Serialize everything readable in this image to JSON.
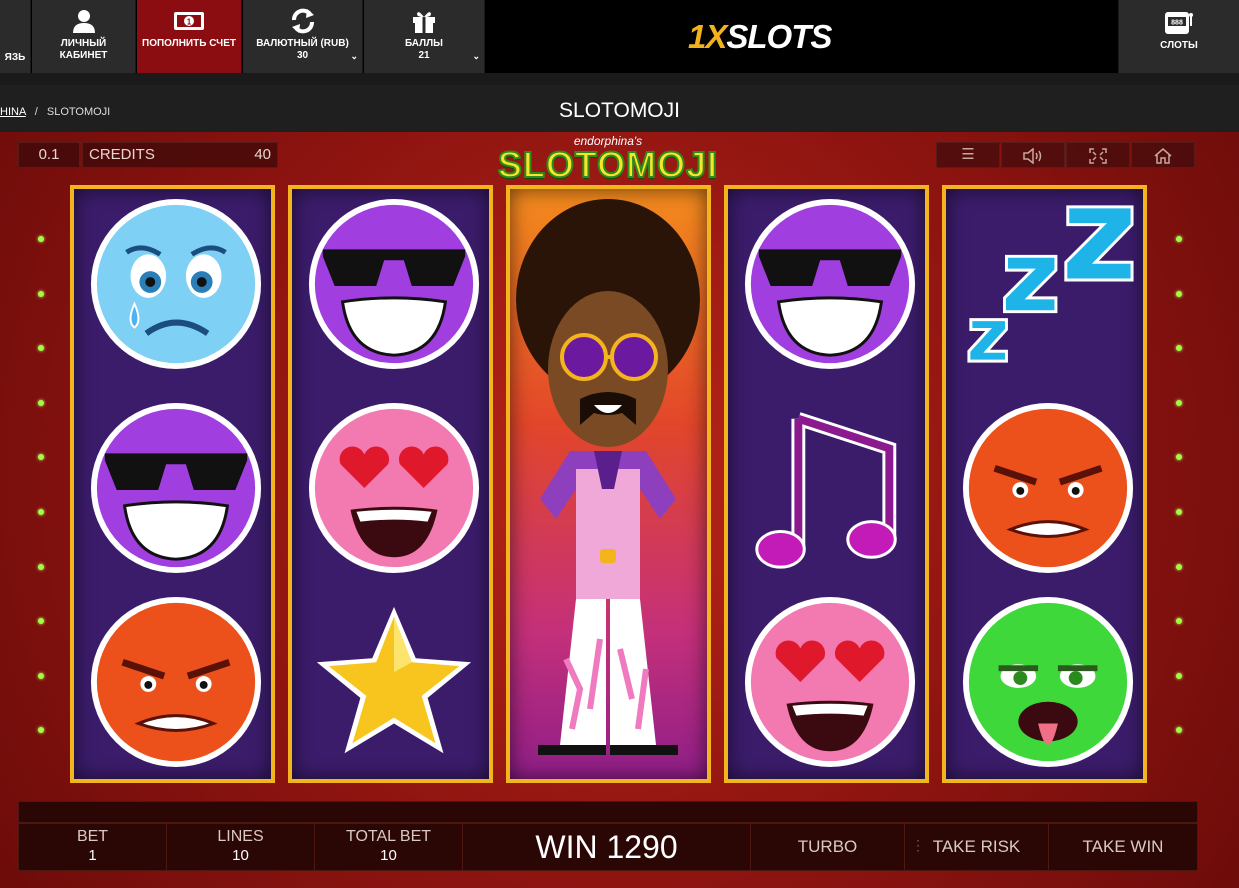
{
  "nav": {
    "partial_label": "ЯЗЬ",
    "items": [
      {
        "label": "ЛИЧНЫЙ КАБИНЕТ",
        "icon": "user-icon"
      },
      {
        "label": "ПОПОЛНИТЬ СЧЕТ",
        "icon": "deposit-icon"
      },
      {
        "label": "ВАЛЮТНЫЙ (RUB)",
        "value": "30",
        "icon": "refresh-icon"
      },
      {
        "label": "БАЛЛЫ",
        "value": "21",
        "icon": "gift-icon"
      }
    ],
    "logo_one": "1X",
    "logo_rest": "SLOTS",
    "slots_label": "СЛОТЫ"
  },
  "breadcrumb": {
    "parent": "HINA",
    "separator": "/",
    "current": "SLOTOMOJI"
  },
  "page_title": "SLOTOMOJI",
  "hud": {
    "coin_value": "0.1",
    "credits_label": "CREDITS",
    "credits_value": "40",
    "brand_sub": "endorphina's",
    "brand_main": "SLOTOMOJI"
  },
  "reels": [
    [
      "sad-face",
      "cool-face",
      "angry-face"
    ],
    [
      "cool-face",
      "heart-eyes-face",
      "star"
    ],
    [
      "disco-man-wild"
    ],
    [
      "cool-face",
      "music-note",
      "heart-eyes-face"
    ],
    [
      "zzz",
      "angry-face",
      "sick-face"
    ]
  ],
  "bottom": {
    "bet_label": "BET",
    "bet_value": "1",
    "lines_label": "LINES",
    "lines_value": "10",
    "total_label": "TOTAL BET",
    "total_value": "10",
    "win_text": "WIN 1290",
    "turbo_label": "TURBO",
    "take_risk_label": "TAKE RISK",
    "take_win_label": "TAKE WIN"
  },
  "colors": {
    "reel_border": "#f4b41e",
    "reel_bg": "#3b1c6b",
    "accent_red": "#8b0d12",
    "line_dot": "#9dff3f"
  }
}
